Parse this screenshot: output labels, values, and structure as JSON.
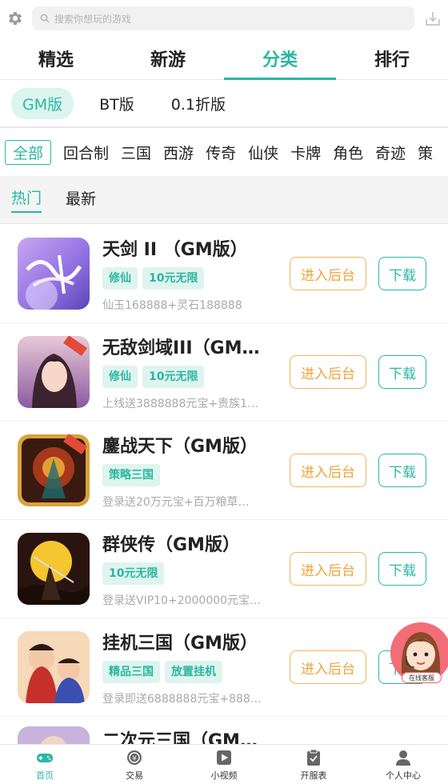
{
  "search": {
    "placeholder": "搜索你想玩的游戏"
  },
  "main_tabs": [
    {
      "label": "精选"
    },
    {
      "label": "新游"
    },
    {
      "label": "分类",
      "active": true
    },
    {
      "label": "排行"
    }
  ],
  "versions": [
    {
      "label": "GM版",
      "active": true
    },
    {
      "label": "BT版"
    },
    {
      "label": "0.1折版"
    }
  ],
  "categories": [
    {
      "label": "全部",
      "active": true
    },
    {
      "label": "回合制"
    },
    {
      "label": "三国"
    },
    {
      "label": "西游"
    },
    {
      "label": "传奇"
    },
    {
      "label": "仙侠"
    },
    {
      "label": "卡牌"
    },
    {
      "label": "角色"
    },
    {
      "label": "奇迹"
    },
    {
      "label": "策"
    }
  ],
  "sort_tabs": [
    {
      "label": "热门",
      "active": true
    },
    {
      "label": "最新"
    }
  ],
  "games": [
    {
      "name": "天剑 II （GM版）",
      "tags": [
        "修仙",
        "10元无限"
      ],
      "desc": "仙玉168888+灵石188888",
      "btn_admin": "进入后台",
      "btn_download": "下载"
    },
    {
      "name": "无敌剑域III（GM…",
      "tags": [
        "修仙",
        "10元无限"
      ],
      "desc": "上线送3888888元宝+贵族1…",
      "btn_admin": "进入后台",
      "btn_download": "下载"
    },
    {
      "name": "鏖战天下（GM版）",
      "tags": [
        "策略三国"
      ],
      "desc": "登录送20万元宝+百万粮草…",
      "btn_admin": "进入后台",
      "btn_download": "下载"
    },
    {
      "name": "群侠传（GM版）",
      "tags": [
        "10元无限"
      ],
      "desc": "登录送VIP10+2000000元宝…",
      "btn_admin": "进入后台",
      "btn_download": "下载"
    },
    {
      "name": "挂机三国（GM版）",
      "tags": [
        "精品三国",
        "放置挂机"
      ],
      "desc": "登录即送6888888元宝+888…",
      "btn_admin": "进入后台",
      "btn_download": "下载"
    },
    {
      "name": "二次元三国（GM…"
    }
  ],
  "support": {
    "label": "在线客服"
  },
  "bottom_nav": [
    {
      "label": "首页",
      "icon": "gamepad-icon",
      "active": true
    },
    {
      "label": "交易",
      "icon": "trade-icon"
    },
    {
      "label": "小视频",
      "icon": "video-icon"
    },
    {
      "label": "开服表",
      "icon": "clipboard-icon"
    },
    {
      "label": "个人中心",
      "icon": "person-icon"
    }
  ],
  "colors": {
    "accent": "#2ab7a0",
    "tag_bg": "#dff4ee",
    "admin_btn": "#f0a43a"
  }
}
